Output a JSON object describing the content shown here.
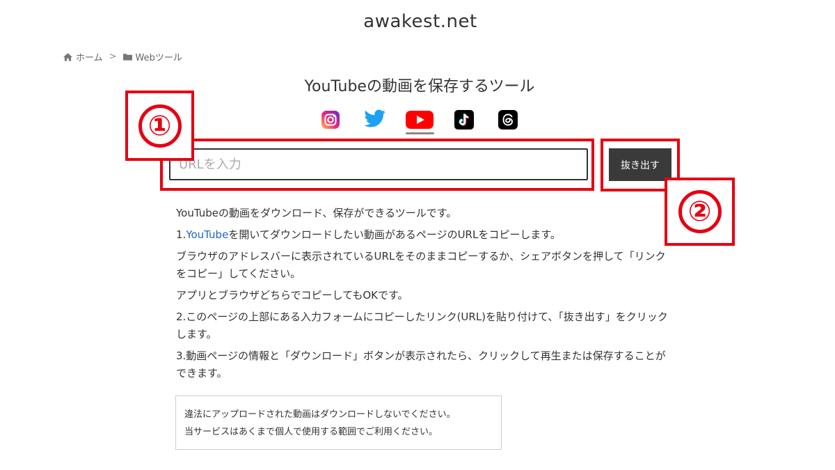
{
  "site": {
    "title": "awakest.net"
  },
  "breadcrumb": {
    "home": "ホーム",
    "separator": ">",
    "category": "Webツール"
  },
  "page": {
    "title": "YouTubeの動画を保存するツール"
  },
  "social_tabs": [
    {
      "icon": "instagram-icon"
    },
    {
      "icon": "twitter-icon"
    },
    {
      "icon": "youtube-icon",
      "active": true
    },
    {
      "icon": "tiktok-icon"
    },
    {
      "icon": "threads-icon"
    }
  ],
  "form": {
    "url_placeholder": "URLを入力",
    "url_value": "",
    "extract_label": "抜き出す"
  },
  "annotations": [
    {
      "label": "①",
      "target": "url-input"
    },
    {
      "label": "②",
      "target": "extract-button"
    }
  ],
  "description": {
    "intro": "YouTubeの動画をダウンロード、保存ができるツールです。",
    "step1_prefix": "1.",
    "step1_link": "YouTube",
    "step1_rest": "を開いてダウンロードしたい動画があるページのURLをコピーします。",
    "step1_detail": "ブラウザのアドレスバーに表示されているURLをそのままコピーするか、シェアボタンを押して「リンクをコピー」してください。",
    "step1_note": "アプリとブラウザどちらでコピーしてもOKです。",
    "step2": "2.このページの上部にある入力フォームにコピーしたリンク(URL)を貼り付けて、「抜き出す」をクリックします。",
    "step3": "3.動画ページの情報と「ダウンロード」ボタンが表示されたら、クリックして再生または保存することができます。"
  },
  "notice": {
    "line1": "違法にアップロードされた動画はダウンロードしないでください。",
    "line2": "当サービスはあくまで個人で使用する範囲でご利用ください。"
  },
  "colors": {
    "annotation_red": "#e60012",
    "button_bg": "#3a3a3a",
    "link_blue": "#1a66cc",
    "youtube_red": "#ff0000"
  }
}
